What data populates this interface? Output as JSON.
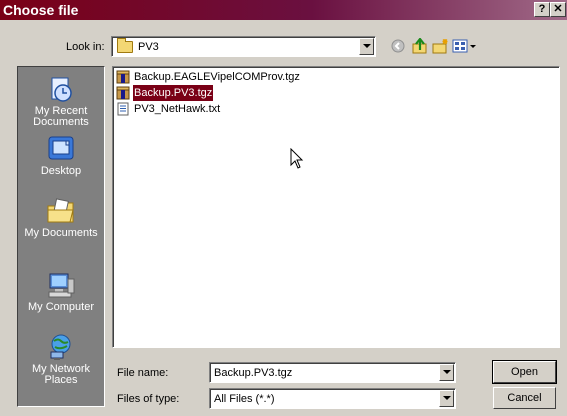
{
  "window": {
    "title": "Choose file",
    "help_glyph": "?",
    "close_glyph": "✕"
  },
  "look_in": {
    "label": "Look in:",
    "value": "PV3"
  },
  "toolbar": {
    "icons": [
      "back-icon",
      "up-folder-icon",
      "new-folder-icon",
      "view-menu-icon"
    ]
  },
  "places": [
    {
      "label": "My Recent Documents",
      "icon": "recent-documents-icon"
    },
    {
      "label": "Desktop",
      "icon": "desktop-icon"
    },
    {
      "label": "My Documents",
      "icon": "my-documents-icon"
    },
    {
      "label": "My Computer",
      "icon": "my-computer-icon"
    },
    {
      "label": "My Network Places",
      "icon": "network-places-icon"
    }
  ],
  "files": [
    {
      "name": "Backup.EAGLEVipelCOMProv.tgz",
      "icon": "archive-icon",
      "selected": false
    },
    {
      "name": "Backup.PV3.tgz",
      "icon": "archive-icon",
      "selected": true
    },
    {
      "name": "PV3_NetHawk.txt",
      "icon": "text-file-icon",
      "selected": false
    }
  ],
  "file_name": {
    "label": "File name:",
    "value": "Backup.PV3.tgz"
  },
  "file_type": {
    "label": "Files of type:",
    "value": "All Files (*.*)"
  },
  "buttons": {
    "open": "Open",
    "cancel": "Cancel"
  },
  "colors": {
    "title_bar": "#7a0016",
    "selection": "#7a0016",
    "dialog_bg": "#d4d0c8",
    "places_bg": "#808080"
  }
}
